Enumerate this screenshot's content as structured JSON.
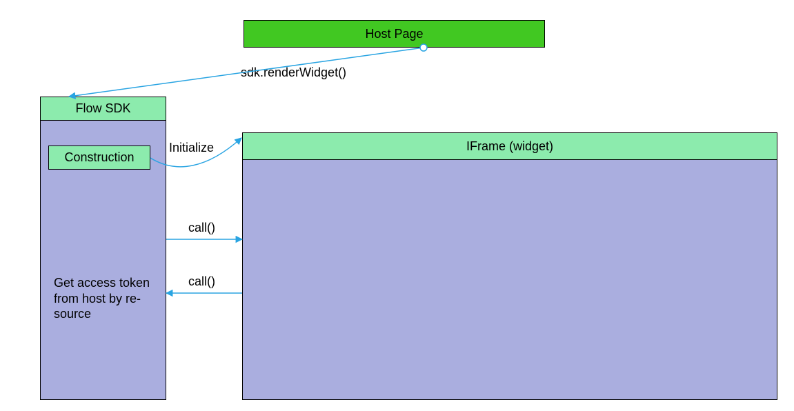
{
  "hostPage": {
    "label": "Host Page"
  },
  "flowSdk": {
    "header": "Flow SDK",
    "construction": "Construction",
    "tokenText": "Get access token from host by re- source"
  },
  "iframe": {
    "header": "IFrame (widget)"
  },
  "labels": {
    "renderWidget": "sdk.renderWidget()",
    "initialize": "Initialize",
    "call1": "call()",
    "call2": "call()"
  },
  "colors": {
    "brightGreen": "#41c822",
    "mintGreen": "#8cebad",
    "lavender": "#aaaedf",
    "arrowBlue": "#29a4e2"
  }
}
